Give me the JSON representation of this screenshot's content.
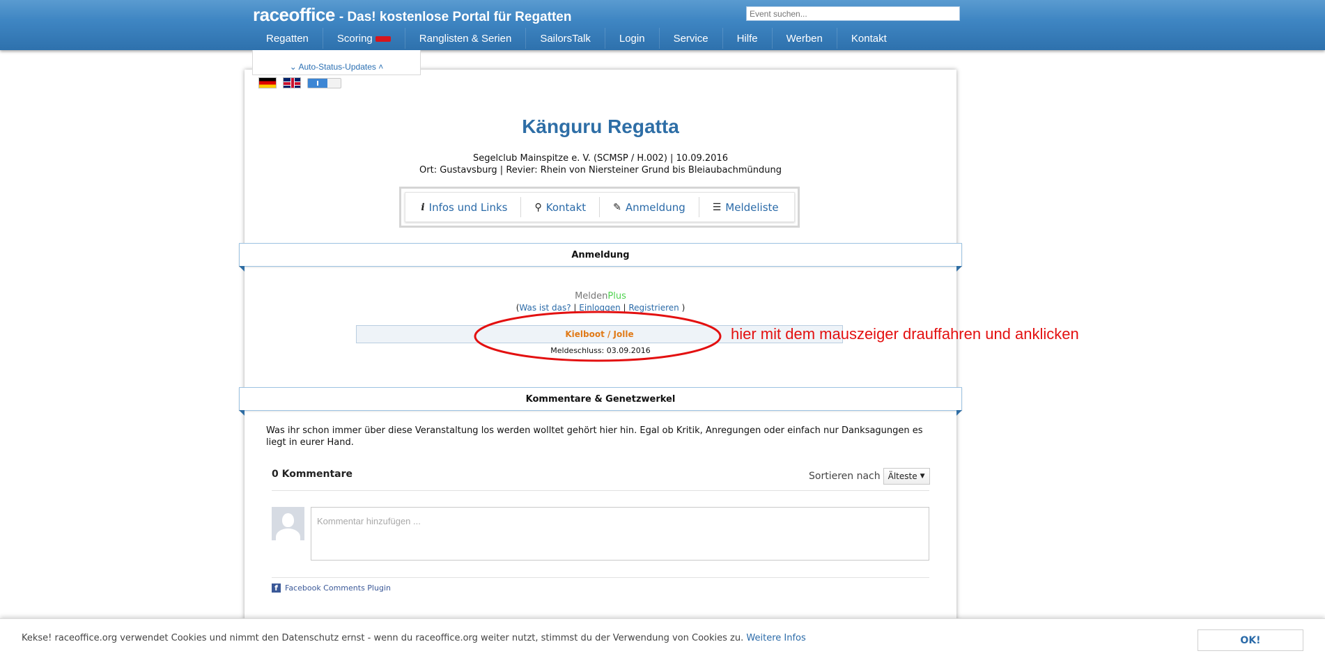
{
  "header": {
    "brand": "raceoffice",
    "tagline": "- Das! kostenlose Portal für Regatten",
    "search_placeholder": "Event suchen..."
  },
  "nav": [
    {
      "label": "Regatten"
    },
    {
      "label": "Scoring",
      "badge": "new"
    },
    {
      "label": "Ranglisten & Serien"
    },
    {
      "label": "SailorsTalk"
    },
    {
      "label": "Login"
    },
    {
      "label": "Service"
    },
    {
      "label": "Hilfe"
    },
    {
      "label": "Werben"
    },
    {
      "label": "Kontakt"
    }
  ],
  "auto_status": {
    "label": "Auto-Status-Updates"
  },
  "event": {
    "title": "Känguru Regatta",
    "line1": "Segelclub Mainspitze e. V. (SCMSP / H.002) | 10.09.2016",
    "line2": "Ort: Gustavsburg | Revier: Rhein von Niersteiner Grund bis Bleiaubachmündung"
  },
  "tabs": [
    {
      "label": "Infos und Links",
      "icon": "info-icon"
    },
    {
      "label": "Kontakt",
      "icon": "pin-icon"
    },
    {
      "label": "Anmeldung",
      "icon": "pencil-icon"
    },
    {
      "label": "Meldeliste",
      "icon": "list-icon"
    }
  ],
  "anmeldung": {
    "section_title": "Anmeldung",
    "melden": "Melden",
    "plus": "Plus",
    "link_what": "Was ist das?",
    "link_login": "Einloggen",
    "link_register": "Registrieren",
    "klasse": "Kielboot / Jolle",
    "meldeschluss": "Meldeschluss: 03.09.2016"
  },
  "annotation": {
    "text": "hier mit dem mauszeiger drauffahren und anklicken",
    "color": "#e31010"
  },
  "kommentare": {
    "section_title": "Kommentare & Genetzwerkel",
    "description": "Was ihr schon immer über diese Veranstaltung los werden wolltet gehört hier hin. Egal ob Kritik, Anregungen oder einfach nur Danksagungen es liegt in eurer Hand.",
    "count": "0 Kommentare",
    "sort_label": "Sortieren nach",
    "sort_value": "Älteste",
    "placeholder": "Kommentar hinzufügen ...",
    "plugin": "Facebook Comments Plugin"
  },
  "cookie": {
    "text": "Kekse! raceoffice.org verwendet Cookies und nimmt den Datenschutz ernst - wenn du raceoffice.org weiter nutzt, stimmst du der Verwendung von Cookies zu.",
    "link": "Weitere Infos",
    "ok": "OK!"
  },
  "colors": {
    "header_blue": "#3f86c3",
    "title_blue": "#2e6ea6",
    "orange": "#e07a18"
  }
}
